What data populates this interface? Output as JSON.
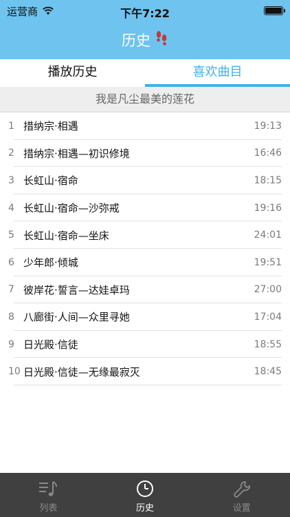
{
  "status_bar": {
    "carrier": "运营商",
    "time": "下午7:22",
    "battery_level": 1.0
  },
  "nav": {
    "title": "历史"
  },
  "tabs": [
    {
      "label": "播放历史",
      "active": false
    },
    {
      "label": "喜欢曲目",
      "active": true
    }
  ],
  "section": {
    "title": "我是凡尘最美的莲花"
  },
  "tracks": [
    {
      "index": "1",
      "title": "措纳宗·相遇",
      "time": "19:13"
    },
    {
      "index": "2",
      "title": "措纳宗·相遇—初识修境",
      "time": "16:46"
    },
    {
      "index": "3",
      "title": "长虹山·宿命",
      "time": "18:15"
    },
    {
      "index": "4",
      "title": "长虹山·宿命—沙弥戒",
      "time": "19:16"
    },
    {
      "index": "5",
      "title": "长虹山·宿命—坐床",
      "time": "24:01"
    },
    {
      "index": "6",
      "title": "少年郎·倾城",
      "time": "19:51"
    },
    {
      "index": "7",
      "title": "彼岸花·誓言—达娃卓玛",
      "time": "27:00"
    },
    {
      "index": "8",
      "title": "八廊街·人间—众里寻她",
      "time": "17:04"
    },
    {
      "index": "9",
      "title": "日光殿·信徒",
      "time": "18:55"
    },
    {
      "index": "10",
      "title": "日光殿·信徒—无缘最寂灭",
      "time": "18:45"
    }
  ],
  "tabbar": [
    {
      "label": "列表",
      "icon": "music-list-icon",
      "selected": false
    },
    {
      "label": "历史",
      "icon": "clock-icon",
      "selected": true
    },
    {
      "label": "设置",
      "icon": "wrench-icon",
      "selected": false
    }
  ],
  "colors": {
    "header": "#6ec4ef",
    "accent": "#3fb2ea",
    "tabbar": "#404040",
    "section_bg": "#eeeeee"
  }
}
